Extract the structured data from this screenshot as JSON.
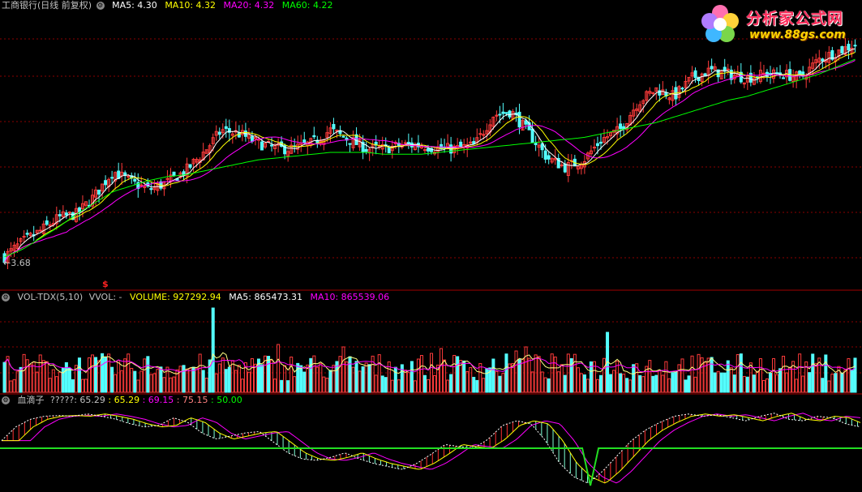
{
  "header_price": {
    "title": "工商银行(日线 前复权)",
    "ma5": "MA5: 4.30",
    "ma10": "MA10: 4.32",
    "ma20": "MA20: 4.32",
    "ma60": "MA60: 4.22"
  },
  "header_vol": {
    "title": "VOL-TDX(5,10)",
    "vvol": "VVOL: -",
    "volume": "VOLUME: 927292.94",
    "ma5": "MA5: 865473.31",
    "ma10": "MA10: 865539.06"
  },
  "header_ind": {
    "title": "血滴子",
    "v1": "?????: 65.29",
    "v2": ": 65.29",
    "v3": ": 69.15",
    "v4": ": 75.15",
    "v5": ": 50.00"
  },
  "price_low_label": "3.68",
  "dollar_mark": "$",
  "watermark": {
    "brand": "分析家公式网",
    "url": "www.88gs.com"
  },
  "colors": {
    "up": "#ff3b3b",
    "down": "#54ffff",
    "ma5": "#ffffff",
    "ma10": "#ffff00",
    "ma20": "#ff00ff",
    "ma60": "#00ff00",
    "grid": "#8b0000"
  },
  "chart_data": [
    {
      "type": "candlestick",
      "title": "工商银行(日线 前复权)",
      "ylim": [
        3.68,
        4.95
      ],
      "series": [
        {
          "name": "MA5",
          "value": 4.3
        },
        {
          "name": "MA10",
          "value": 4.32
        },
        {
          "name": "MA20",
          "value": 4.32
        },
        {
          "name": "MA60",
          "value": 4.22
        }
      ],
      "close_path": [
        3.72,
        3.8,
        3.86,
        3.93,
        3.95,
        4.05,
        4.18,
        4.12,
        4.08,
        4.12,
        4.18,
        4.28,
        4.4,
        4.38,
        4.33,
        4.3,
        4.3,
        4.33,
        4.4,
        4.35,
        4.3,
        4.3,
        4.32,
        4.32,
        4.3,
        4.3,
        4.32,
        4.48,
        4.5,
        4.38,
        4.25,
        4.2,
        4.24,
        4.35,
        4.4,
        4.55,
        4.62,
        4.58,
        4.68,
        4.72,
        4.7,
        4.68,
        4.7,
        4.7,
        4.68,
        4.78,
        4.82,
        4.86
      ],
      "ma60_path": [
        3.72,
        3.76,
        3.82,
        3.88,
        3.95,
        4.01,
        4.07,
        4.1,
        4.13,
        4.15,
        4.16,
        4.18,
        4.2,
        4.22,
        4.24,
        4.25,
        4.26,
        4.27,
        4.28,
        4.28,
        4.28,
        4.27,
        4.27,
        4.27,
        4.28,
        4.29,
        4.3,
        4.31,
        4.32,
        4.33,
        4.34,
        4.35,
        4.36,
        4.38,
        4.4,
        4.42,
        4.44,
        4.47,
        4.5,
        4.53,
        4.56,
        4.58,
        4.61,
        4.64,
        4.67,
        4.7,
        4.74,
        4.78
      ]
    },
    {
      "type": "bar",
      "title": "VOL-TDX(5,10)",
      "series": [
        {
          "name": "VOLUME",
          "value": 927292.94
        },
        {
          "name": "MA5",
          "value": 865473.31
        },
        {
          "name": "MA10",
          "value": 865539.06
        }
      ]
    },
    {
      "type": "line",
      "title": "血滴子",
      "ylim": [
        0,
        100
      ],
      "reference_line": 50.0,
      "series": [
        {
          "name": "?????",
          "value": 65.29
        },
        {
          "name": "",
          "value": 69.15
        },
        {
          "name": "",
          "value": 75.15
        }
      ],
      "path": [
        60,
        78,
        88,
        92,
        93,
        92,
        95,
        92,
        88,
        82,
        78,
        80,
        90,
        84,
        70,
        62,
        66,
        70,
        72,
        58,
        44,
        36,
        34,
        38,
        44,
        36,
        30,
        26,
        22,
        30,
        42,
        55,
        52,
        50,
        62,
        80,
        86,
        82,
        60,
        30,
        12,
        4,
        20,
        40,
        60,
        74,
        84,
        92,
        95,
        92,
        94,
        90,
        86,
        92,
        96,
        88,
        86,
        92,
        90,
        82,
        78
      ]
    }
  ]
}
